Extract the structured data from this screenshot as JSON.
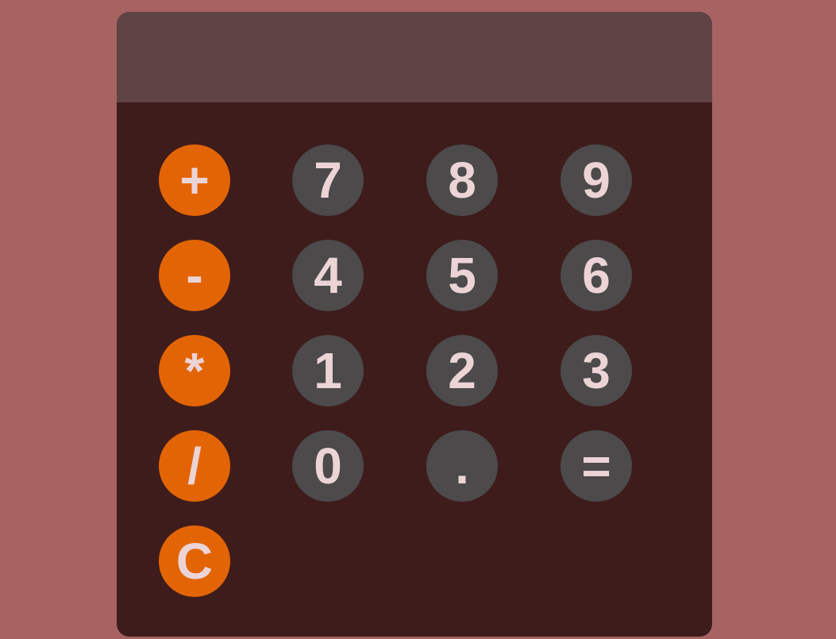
{
  "display": {
    "value": ""
  },
  "keys": {
    "plus": "+",
    "minus": "-",
    "multiply": "*",
    "divide": "/",
    "clear": "C",
    "seven": "7",
    "eight": "8",
    "nine": "9",
    "four": "4",
    "five": "5",
    "six": "6",
    "one": "1",
    "two": "2",
    "three": "3",
    "zero": "0",
    "decimal": ".",
    "equals": "="
  },
  "colors": {
    "page_background": "#a66361",
    "calculator_body": "#3e1c1c",
    "display_background": "#5f4345",
    "operator_key": "#e36404",
    "number_key": "#4c4a4b",
    "key_text": "#ecd4d6"
  }
}
